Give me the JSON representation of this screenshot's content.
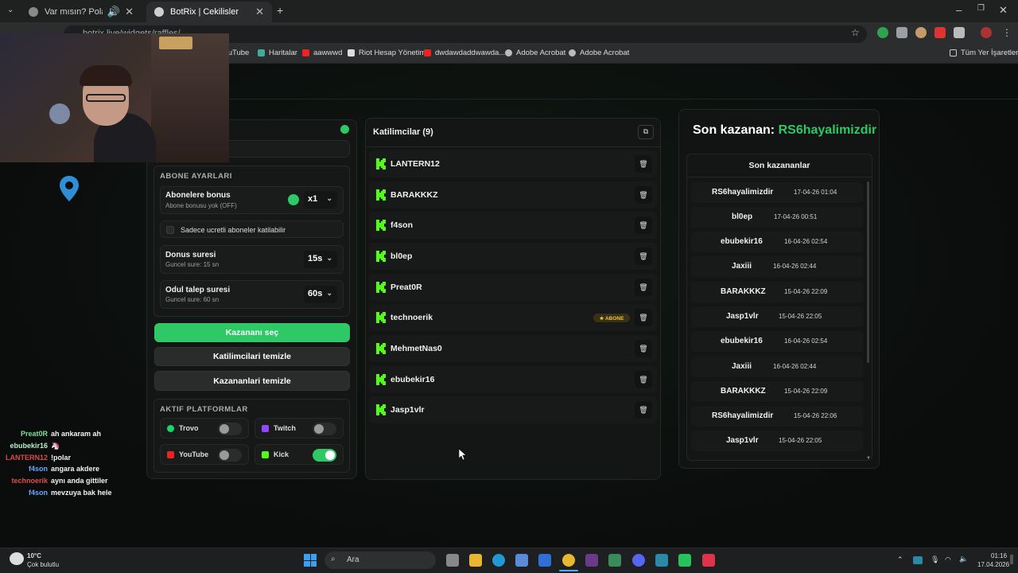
{
  "browser": {
    "tabs": [
      {
        "title": "Var mısın? Polar mısın?"
      },
      {
        "title": "BotRix | Cekilisler"
      }
    ],
    "new_tab": "+",
    "address": "botrix.live/widgets/raffles/",
    "bookmarks": [
      "YouTube",
      "Haritalar",
      "aawwwd",
      "Riot Hesap Yönetimi",
      "dwdawdaddwawda...",
      "Adobe Acrobat",
      "Adobe Acrobat"
    ],
    "all_bookmarks": "Tüm Yer İşaretleri"
  },
  "settings": {
    "subscriber_section": "ABONE AYARLARI",
    "sub_bonus_label": "Abonelere bonus",
    "sub_bonus_sub": "Abone bonusu yok (OFF)",
    "sub_bonus_value": "x1",
    "paid_only_label": "Sadece ucretli aboneler katilabilir",
    "spin_label": "Donus suresi",
    "spin_sub": "Guncel sure: 15 sn",
    "spin_value": "15s",
    "claim_label": "Odul talep suresi",
    "claim_sub": "Guncel sure: 60 sn",
    "claim_value": "60s",
    "pick_winner": "Kazananı seç",
    "clear_participants": "Katilimcilari temizle",
    "clear_winners": "Kazananlari temizle",
    "platforms_section": "AKTIF PLATFORMLAR",
    "platforms": [
      {
        "name": "Trovo",
        "on": false
      },
      {
        "name": "Twitch",
        "on": false
      },
      {
        "name": "YouTube",
        "on": false
      },
      {
        "name": "Kick",
        "on": true
      }
    ]
  },
  "participants": {
    "title": "Katilimcilar (9)",
    "badge": "★ ABONE",
    "list": [
      "LANTERN12",
      "BARAKKKZ",
      "f4son",
      "bl0ep",
      "Preat0R",
      "technoerik",
      "MehmetNas0",
      "ebubekir16",
      "Jasp1vlr"
    ]
  },
  "winners": {
    "title_prefix": "Son kazanan:",
    "title_name": "RS6hayalimizdir",
    "list_title": "Son kazananlar",
    "list": [
      {
        "name": "RS6hayalimizdir",
        "date": "17-04-26 01:04"
      },
      {
        "name": "bl0ep",
        "date": "17-04-26 00:51"
      },
      {
        "name": "ebubekir16",
        "date": "16-04-26 02:54"
      },
      {
        "name": "Jaxiii",
        "date": "16-04-26 02:44"
      },
      {
        "name": "BARAKKKZ",
        "date": "15-04-26 22:09"
      },
      {
        "name": "Jasp1vlr",
        "date": "15-04-26 22:05"
      },
      {
        "name": "ebubekir16",
        "date": "16-04-26 02:54"
      },
      {
        "name": "Jaxiii",
        "date": "16-04-26 02:44"
      },
      {
        "name": "BARAKKKZ",
        "date": "15-04-26 22:09"
      },
      {
        "name": "RS6hayalimizdir",
        "date": "15-04-26 22:06"
      },
      {
        "name": "Jasp1vlr",
        "date": "15-04-26 22:05"
      }
    ]
  },
  "chat": [
    {
      "user": "Preat0R",
      "msg": "ah ankaram ah",
      "color": "#7de09a"
    },
    {
      "user": "ebubekir16",
      "msg": "🦄",
      "color": "#b6f0c8"
    },
    {
      "user": "LANTERN12",
      "msg": "!polar",
      "color": "#d94a4a"
    },
    {
      "user": "f4son",
      "msg": "angara akdere",
      "color": "#6aa6ff"
    },
    {
      "user": "technoerik",
      "msg": "aynı anda gittiler",
      "color": "#e24b4b"
    },
    {
      "user": "f4son",
      "msg": "mevzuya bak hele",
      "color": "#6aa6ff"
    }
  ],
  "taskbar": {
    "weather_temp": "10°C",
    "weather_desc": "Çok bulutlu",
    "search": "Ara",
    "time": "01:16",
    "date": "17.04.2026"
  },
  "colors": {
    "accent": "#2ec866",
    "kick": "#53fc18"
  }
}
